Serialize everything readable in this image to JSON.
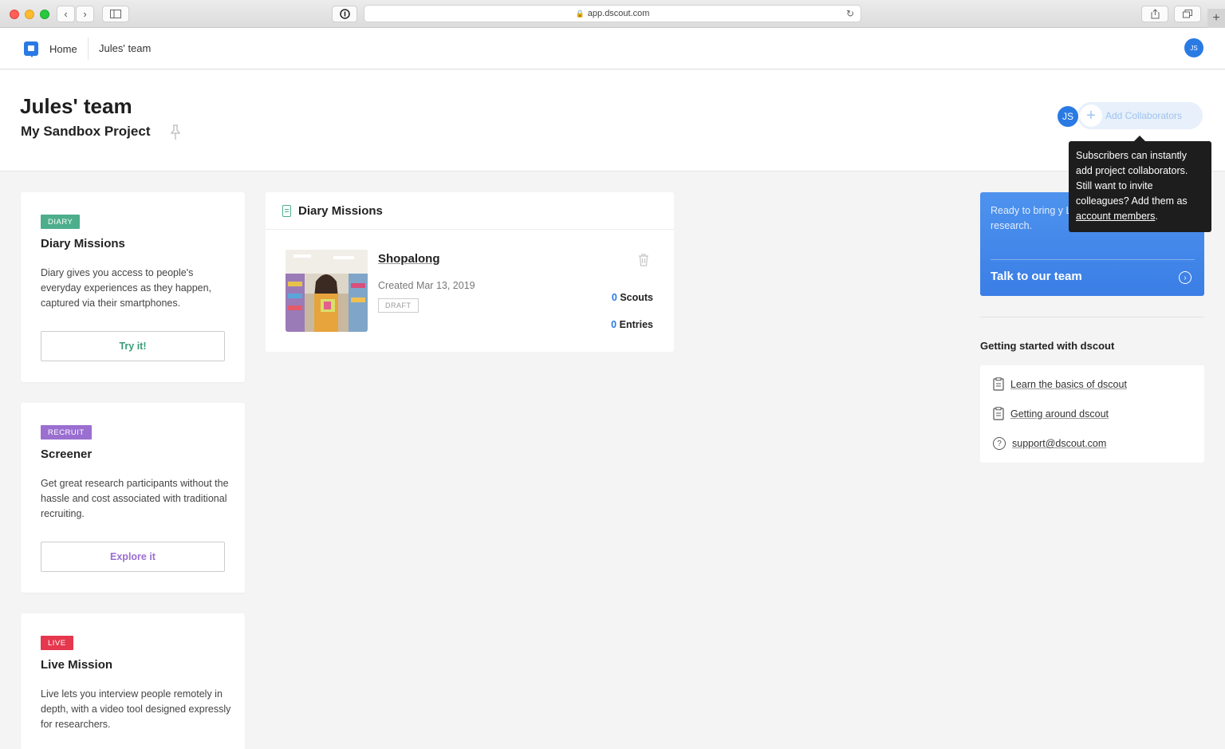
{
  "browser": {
    "url": "app.dscout.com"
  },
  "nav": {
    "home": "Home",
    "team": "Jules' team",
    "avatar_initials": "JS"
  },
  "header": {
    "title": "Jules' team",
    "subtitle": "My Sandbox Project",
    "avatar_initials": "JS",
    "add_collaborators": "Add Collaborators"
  },
  "tooltip": {
    "text": "Subscribers can instantly add project collaborators. Still want to invite colleagues? Add them as",
    "link": "account members",
    "end": "."
  },
  "mission_types": [
    {
      "badge": "DIARY",
      "badge_color": "#4dae8c",
      "title": "Diary Missions",
      "description": "Diary gives you access to people's everyday experiences as they happen, captured via their smartphones.",
      "button": "Try it!",
      "button_color": "#3a9d78"
    },
    {
      "badge": "RECRUIT",
      "badge_color": "#9a6fd0",
      "title": "Screener",
      "description": "Get great research participants without the hassle and cost associated with traditional recruiting.",
      "button": "Explore it",
      "button_color": "#9a6fd0"
    },
    {
      "badge": "LIVE",
      "badge_color": "#e5374e",
      "title": "Live Mission",
      "description": "Live lets you interview people remotely in depth, with a video tool designed expressly for researchers.",
      "button": "",
      "button_color": "#e5374e"
    }
  ],
  "missions_panel": {
    "title": "Diary Missions",
    "mission": {
      "name": "Shopalong",
      "created": "Created Mar 13, 2019",
      "status": "DRAFT",
      "scouts_count": "0",
      "scouts_label": "Scouts",
      "entries_count": "0",
      "entries_label": "Entries"
    }
  },
  "cta": {
    "text": "Ready to bring y Learn how to get research.",
    "link": "Talk to our team"
  },
  "getting_started": {
    "title": "Getting started with dscout",
    "items": [
      {
        "label": "Learn the basics of dscout",
        "icon": "clipboard-icon"
      },
      {
        "label": "Getting around dscout",
        "icon": "clipboard-icon"
      },
      {
        "label": "support@dscout.com",
        "icon": "help-icon"
      }
    ]
  }
}
